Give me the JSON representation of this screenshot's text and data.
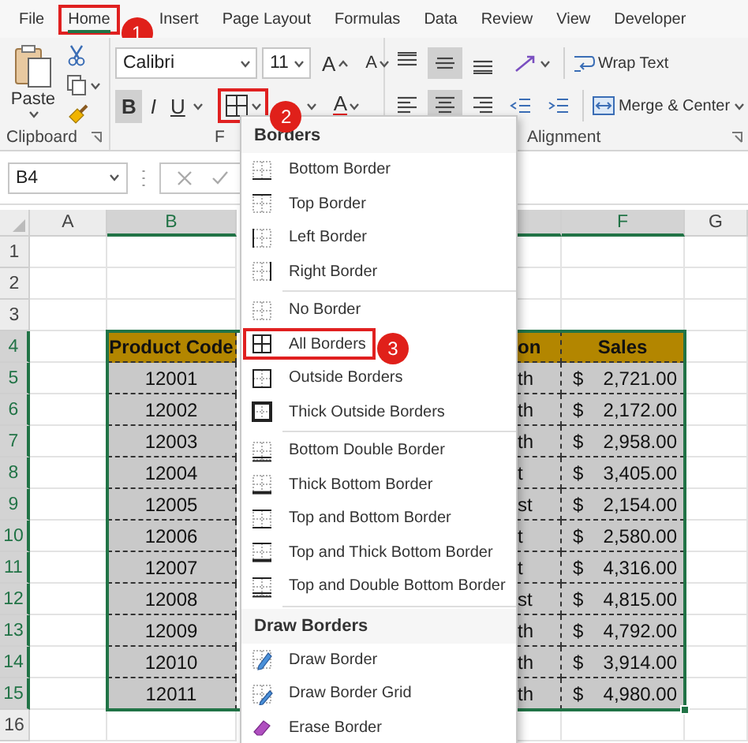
{
  "tabs": [
    {
      "label": "File",
      "selected": false
    },
    {
      "label": "Home",
      "selected": true,
      "callout": "1"
    },
    {
      "label": "Insert",
      "selected": false
    },
    {
      "label": "Page Layout",
      "selected": false
    },
    {
      "label": "Formulas",
      "selected": false
    },
    {
      "label": "Data",
      "selected": false
    },
    {
      "label": "Review",
      "selected": false
    },
    {
      "label": "View",
      "selected": false
    },
    {
      "label": "Developer",
      "selected": false
    }
  ],
  "ribbon": {
    "clipboard": {
      "paste_label": "Paste",
      "group_label": "Clipboard"
    },
    "font": {
      "font_name": "Calibri",
      "font_size": "11",
      "grow_label": "A",
      "shrink_label": "A",
      "style_buttons": [
        {
          "kind": "bold",
          "label": "B",
          "pressed": true
        },
        {
          "kind": "italic",
          "label": "I",
          "pressed": false
        },
        {
          "kind": "underline",
          "label": "U",
          "pressed": false
        }
      ],
      "borders_callout": "2",
      "font_color_label": "A",
      "group_label": "F"
    },
    "alignment": {
      "vertical": [
        {
          "kind": "top",
          "pressed": false
        },
        {
          "kind": "middle",
          "pressed": true
        },
        {
          "kind": "bottom",
          "pressed": false
        }
      ],
      "horizontal": [
        {
          "kind": "left",
          "pressed": false
        },
        {
          "kind": "center",
          "pressed": true
        },
        {
          "kind": "right",
          "pressed": false
        }
      ],
      "wrap_text": "Wrap Text",
      "merge_center": "Merge & Center",
      "group_label": "Alignment"
    }
  },
  "formula_bar": {
    "name_box": "B4"
  },
  "columns": [
    {
      "label": "A",
      "selected": false
    },
    {
      "label": "B",
      "selected": true
    },
    {
      "selected": true
    },
    {
      "label": "F",
      "selected": true
    },
    {
      "label": "G",
      "selected": false
    }
  ],
  "rows": [
    {
      "number": "1",
      "selected": false
    },
    {
      "number": "2",
      "selected": false
    },
    {
      "number": "3",
      "selected": false
    },
    {
      "number": "4",
      "selected": true,
      "kind": "header",
      "code": "Product Code",
      "region": "on",
      "sales": "Sales"
    },
    {
      "number": "5",
      "selected": true,
      "kind": "data",
      "code": "12001",
      "region": "th",
      "currency": "$",
      "sales": "2,721.00"
    },
    {
      "number": "6",
      "selected": true,
      "kind": "data",
      "code": "12002",
      "region": "th",
      "currency": "$",
      "sales": "2,172.00"
    },
    {
      "number": "7",
      "selected": true,
      "kind": "data",
      "code": "12003",
      "region": "th",
      "currency": "$",
      "sales": "2,958.00"
    },
    {
      "number": "8",
      "selected": true,
      "kind": "data",
      "code": "12004",
      "region": "t",
      "currency": "$",
      "sales": "3,405.00"
    },
    {
      "number": "9",
      "selected": true,
      "kind": "data",
      "code": "12005",
      "region": "st",
      "currency": "$",
      "sales": "2,154.00"
    },
    {
      "number": "10",
      "selected": true,
      "kind": "data",
      "code": "12006",
      "region": "t",
      "currency": "$",
      "sales": "2,580.00"
    },
    {
      "number": "11",
      "selected": true,
      "kind": "data",
      "code": "12007",
      "region": "t",
      "currency": "$",
      "sales": "4,316.00"
    },
    {
      "number": "12",
      "selected": true,
      "kind": "data",
      "code": "12008",
      "region": "st",
      "currency": "$",
      "sales": "4,815.00"
    },
    {
      "number": "13",
      "selected": true,
      "kind": "data",
      "code": "12009",
      "region": "th",
      "currency": "$",
      "sales": "4,792.00"
    },
    {
      "number": "14",
      "selected": true,
      "kind": "data",
      "code": "12010",
      "region": "th",
      "currency": "$",
      "sales": "3,914.00"
    },
    {
      "number": "15",
      "selected": true,
      "kind": "data",
      "code": "12011",
      "region": "th",
      "currency": "$",
      "sales": "4,980.00"
    },
    {
      "number": "16",
      "selected": false
    }
  ],
  "borders_menu": {
    "sections": [
      {
        "title": "Borders",
        "groups": [
          [
            {
              "kind": "bottom",
              "label": "Bottom Border",
              "selected": false
            },
            {
              "kind": "top",
              "label": "Top Border",
              "selected": false
            },
            {
              "kind": "left",
              "label": "Left Border",
              "selected": false
            },
            {
              "kind": "right",
              "label": "Right Border",
              "selected": false
            }
          ],
          [
            {
              "kind": "none",
              "label": "No Border",
              "selected": false
            },
            {
              "kind": "all",
              "label": "All Borders",
              "selected": true,
              "callout": "3"
            },
            {
              "kind": "outside",
              "label": "Outside Borders",
              "selected": false
            },
            {
              "kind": "thick-outside",
              "label": "Thick Outside Borders",
              "selected": false
            }
          ],
          [
            {
              "kind": "bottom-double",
              "label": "Bottom Double Border",
              "selected": false
            },
            {
              "kind": "thick-bottom",
              "label": "Thick Bottom Border",
              "selected": false
            },
            {
              "kind": "top-bottom",
              "label": "Top and Bottom Border",
              "selected": false
            },
            {
              "kind": "top-thick-bottom",
              "label": "Top and Thick Bottom Border",
              "selected": false
            },
            {
              "kind": "top-double-bottom",
              "label": "Top and Double Bottom Border",
              "selected": false
            }
          ]
        ]
      },
      {
        "title": "Draw Borders",
        "groups": [
          [
            {
              "kind": "draw",
              "label": "Draw Border",
              "selected": false
            },
            {
              "kind": "grid",
              "label": "Draw Border Grid",
              "selected": false
            },
            {
              "kind": "erase",
              "label": "Erase Border",
              "selected": false
            }
          ]
        ]
      }
    ]
  }
}
